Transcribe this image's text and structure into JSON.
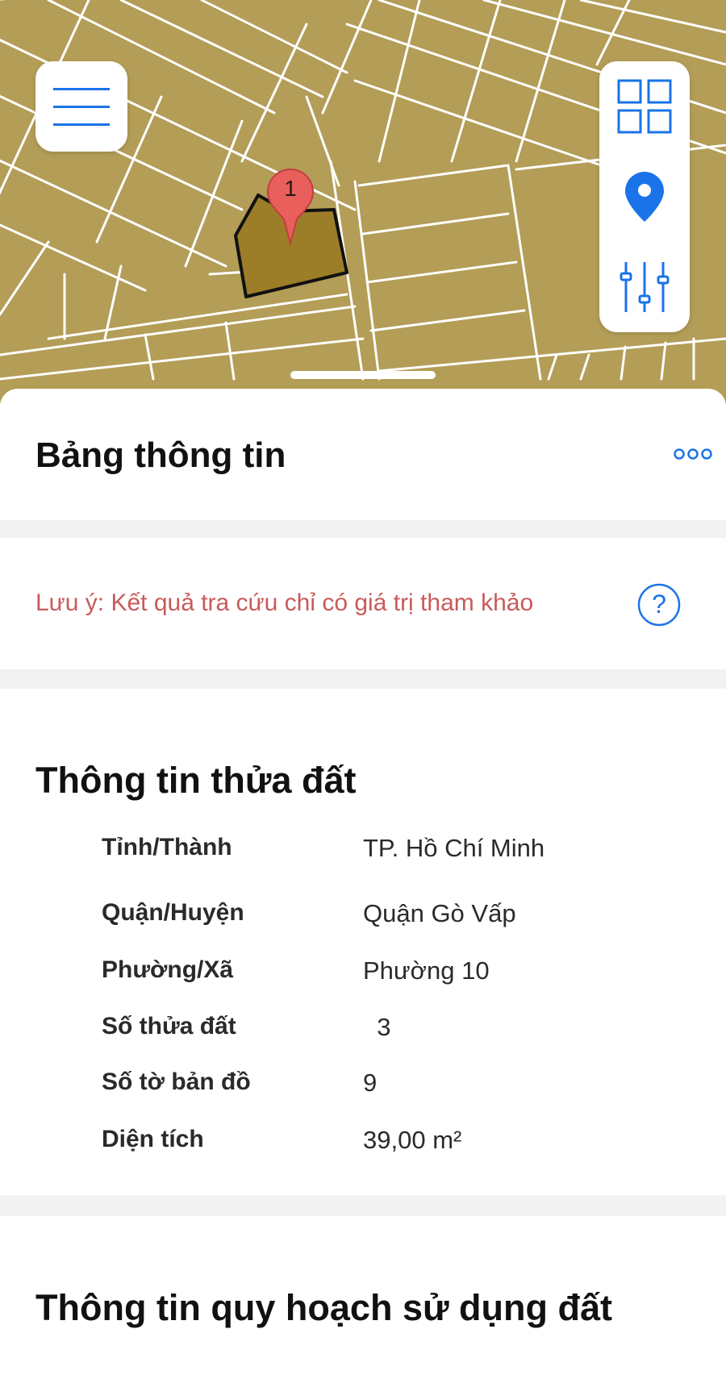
{
  "map": {
    "marker_label": "1",
    "menu_icon": "hamburger-menu-icon",
    "tools": [
      "grid-icon",
      "location-pin-icon",
      "sliders-icon"
    ],
    "colors": {
      "land": "#b39d57",
      "parcel": "#9c7e28",
      "accent": "#1a73e8",
      "marker": "#e85f5c"
    }
  },
  "sheet": {
    "title": "Bảng thông tin",
    "more_icon": "more-dots-icon"
  },
  "note": {
    "text": "Lưu ý: Kết quả tra cứu chỉ có giá trị tham khảo",
    "help": "?"
  },
  "parcel": {
    "title": "Thông tin thửa đất",
    "rows": [
      {
        "label": "Tỉnh/Thành",
        "value": "TP. Hồ Chí Minh"
      },
      {
        "label": "Quận/Huyện",
        "value": "Quận Gò Vấp"
      },
      {
        "label": "Phường/Xã",
        "value": "Phường 10"
      },
      {
        "label": "Số thửa đất",
        "value": "  3"
      },
      {
        "label": "Số tờ bản đồ",
        "value": "9"
      },
      {
        "label": "Diện tích",
        "value": "39,00 m²"
      }
    ]
  },
  "planning": {
    "title": "Thông tin quy hoạch sử dụng đất"
  }
}
